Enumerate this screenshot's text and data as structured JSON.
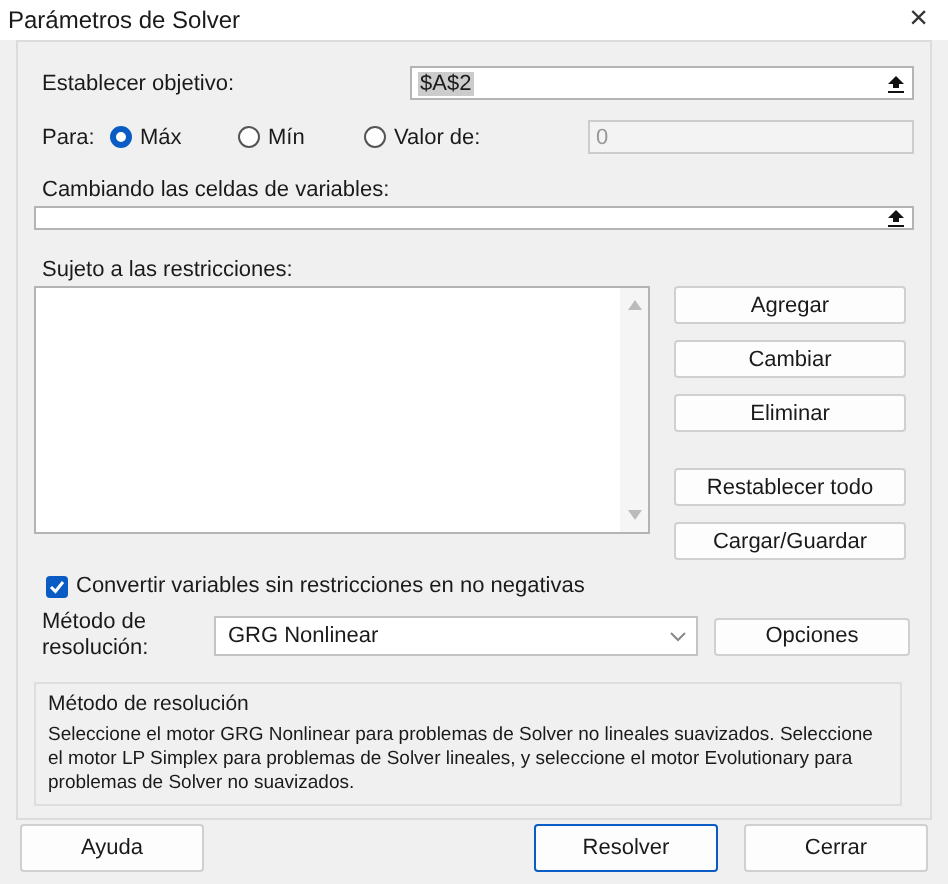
{
  "window": {
    "title": "Parámetros de Solver",
    "close": "×"
  },
  "objective": {
    "label": "Establecer objetivo:",
    "value": "$A$2"
  },
  "to": {
    "label": "Para:",
    "options": [
      {
        "label": "Máx",
        "selected": true
      },
      {
        "label": "Mín",
        "selected": false
      },
      {
        "label": "Valor de:",
        "selected": false
      }
    ],
    "value_field": {
      "value": "0",
      "disabled": true
    }
  },
  "variables": {
    "label": "Cambiando las celdas de variables:"
  },
  "constraints": {
    "label": "Sujeto a las restricciones:",
    "edit_buttons": [
      "Agregar",
      "Cambiar",
      "Eliminar"
    ],
    "file_buttons": [
      "Restablecer todo",
      "Cargar/Guardar"
    ]
  },
  "nonnegative": {
    "label": "Convertir variables sin restricciones en no negativas",
    "checked": true
  },
  "method": {
    "label": "Método de resolución:",
    "value": "GRG Nonlinear",
    "options_button": "Opciones"
  },
  "description": {
    "title": "Método de resolución",
    "text": "Seleccione el motor GRG Nonlinear para problemas de Solver no lineales suavizados. Seleccione el motor LP Simplex para problemas de Solver lineales, y seleccione el motor Evolutionary para problemas de Solver no suavizados."
  },
  "footer": {
    "left": [
      {
        "label": "Ayuda",
        "default": false
      }
    ],
    "right": [
      {
        "label": "Resolver",
        "default": true
      },
      {
        "label": "Cerrar",
        "default": false
      }
    ]
  }
}
